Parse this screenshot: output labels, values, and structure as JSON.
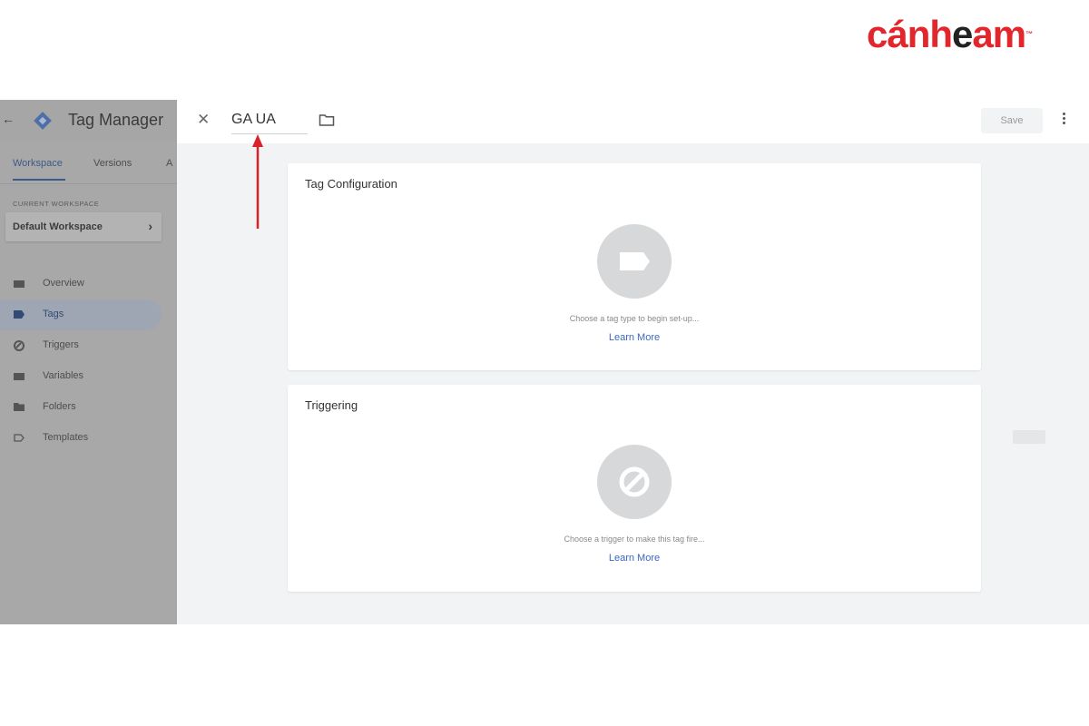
{
  "watermark": {
    "part1": "cánh",
    "part2": "e",
    "part3": "am",
    "tm": "™"
  },
  "sidebar": {
    "app_title": "Tag Manager",
    "tabs": [
      {
        "label": "Workspace",
        "active": true
      },
      {
        "label": "Versions",
        "active": false
      },
      {
        "label": "A",
        "active": false
      }
    ],
    "current_workspace_label": "CURRENT WORKSPACE",
    "workspace_name": "Default Workspace",
    "nav": [
      {
        "label": "Overview",
        "icon": "overview-icon",
        "active": false
      },
      {
        "label": "Tags",
        "icon": "tag-icon",
        "active": true
      },
      {
        "label": "Triggers",
        "icon": "trigger-icon",
        "active": false
      },
      {
        "label": "Variables",
        "icon": "variables-icon",
        "active": false
      },
      {
        "label": "Folders",
        "icon": "folder-icon",
        "active": false
      },
      {
        "label": "Templates",
        "icon": "template-icon",
        "active": false
      }
    ]
  },
  "editor": {
    "tag_name": "GA UA",
    "save_label": "Save",
    "tag_config": {
      "title": "Tag Configuration",
      "hint": "Choose a tag type to begin set-up...",
      "link": "Learn More"
    },
    "triggering": {
      "title": "Triggering",
      "hint": "Choose a trigger to make this tag fire...",
      "link": "Learn More"
    }
  },
  "colors": {
    "accent": "#3b67c0",
    "annotation": "#d9232a",
    "brand": "#e3262b"
  }
}
